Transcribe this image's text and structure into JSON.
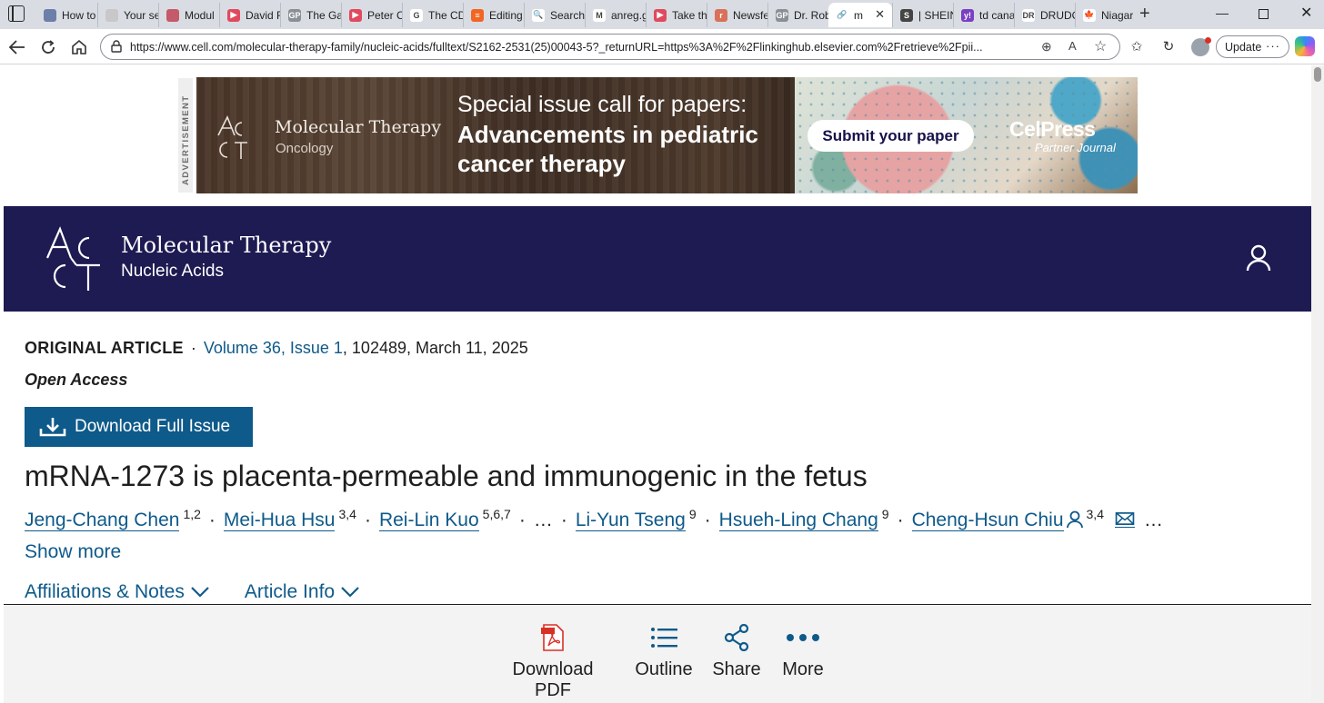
{
  "browser": {
    "tabs": [
      {
        "label": "How to",
        "fav_color": "#6b7fa8",
        "fav_glyph": ""
      },
      {
        "label": "Your se",
        "fav_color": "#c8c8c8",
        "fav_glyph": ""
      },
      {
        "label": "Modul",
        "fav_color": "#c45a6a",
        "fav_glyph": ""
      },
      {
        "label": "David R",
        "fav_color": "#e04a5f",
        "fav_glyph": "▶"
      },
      {
        "label": "The Ga",
        "fav_color": "#8a8f96",
        "fav_glyph": "GP"
      },
      {
        "label": "Peter C",
        "fav_color": "#e04a5f",
        "fav_glyph": "▶"
      },
      {
        "label": "The CD",
        "fav_color": "#ffffff",
        "fav_glyph": "G"
      },
      {
        "label": "Editing",
        "fav_color": "#f26522",
        "fav_glyph": "≡"
      },
      {
        "label": "Search",
        "fav_color": "#ffffff",
        "fav_glyph": "🔍"
      },
      {
        "label": "anreg.g",
        "fav_color": "#ffffff",
        "fav_glyph": "M"
      },
      {
        "label": "Take th",
        "fav_color": "#e04a5f",
        "fav_glyph": "▶"
      },
      {
        "label": "Newsfe",
        "fav_color": "#d9705a",
        "fav_glyph": "r"
      },
      {
        "label": "Dr. Rob",
        "fav_color": "#8a8f96",
        "fav_glyph": "GP"
      },
      {
        "label": "m",
        "fav_color": "#ffffff",
        "fav_glyph": "🔗",
        "active": true
      },
      {
        "label": "| SHEIN",
        "fav_color": "#444444",
        "fav_glyph": "S"
      },
      {
        "label": "td cana",
        "fav_color": "#7b3fc4",
        "fav_glyph": "y!"
      },
      {
        "label": "DRUDG",
        "fav_color": "#ffffff",
        "fav_glyph": "DR"
      },
      {
        "label": "Niagar",
        "fav_color": "#ffffff",
        "fav_glyph": "🍁"
      }
    ],
    "url": "https://www.cell.com/molecular-therapy-family/nucleic-acids/fulltext/S2162-2531(25)00043-5?_returnURL=https%3A%2F%2Flinkinghub.elsevier.com%2Fretrieve%2Fpii...",
    "update_label": "Update",
    "accent": "#0e5a8a"
  },
  "ad": {
    "label": "ADVERTISEMENT",
    "journal_title": "Molecular Therapy",
    "journal_sub": "Oncology",
    "headline_1": "Special issue call for papers:",
    "headline_2": "Advancements in pediatric",
    "headline_3": "cancer therapy",
    "cta": "Submit your paper",
    "brand": "CelPress",
    "brand_sub": "Partner Journal"
  },
  "journal": {
    "title": "Molecular Therapy",
    "subtitle": "Nucleic Acids",
    "banner_color": "#1e1a52"
  },
  "article": {
    "type": "ORIGINAL ARTICLE",
    "separator": "·",
    "volume_link": "Volume 36, Issue 1",
    "citation": ", 102489, March 11, 2025",
    "access": "Open Access",
    "download_issue": "Download Full Issue",
    "title": "mRNA-1273 is placenta-permeable and immunogenic in the fetus",
    "authors": [
      {
        "name": "Jeng-Chang Chen",
        "aff": "1,2"
      },
      {
        "name": "Mei-Hua Hsu",
        "aff": "3,4"
      },
      {
        "name": "Rei-Lin Kuo",
        "aff": "5,6,7"
      },
      {
        "name": "Li-Yun Tseng",
        "aff": "9"
      },
      {
        "name": "Hsueh-Ling Chang",
        "aff": "9"
      },
      {
        "name": "Cheng-Hsun Chiu",
        "aff": "3,4"
      }
    ],
    "ellipsis": "…",
    "show_more": "Show more",
    "affiliations": "Affiliations & Notes",
    "article_info": "Article Info"
  },
  "bottom_bar": {
    "download_pdf": "Download PDF",
    "outline": "Outline",
    "share": "Share",
    "more": "More"
  }
}
